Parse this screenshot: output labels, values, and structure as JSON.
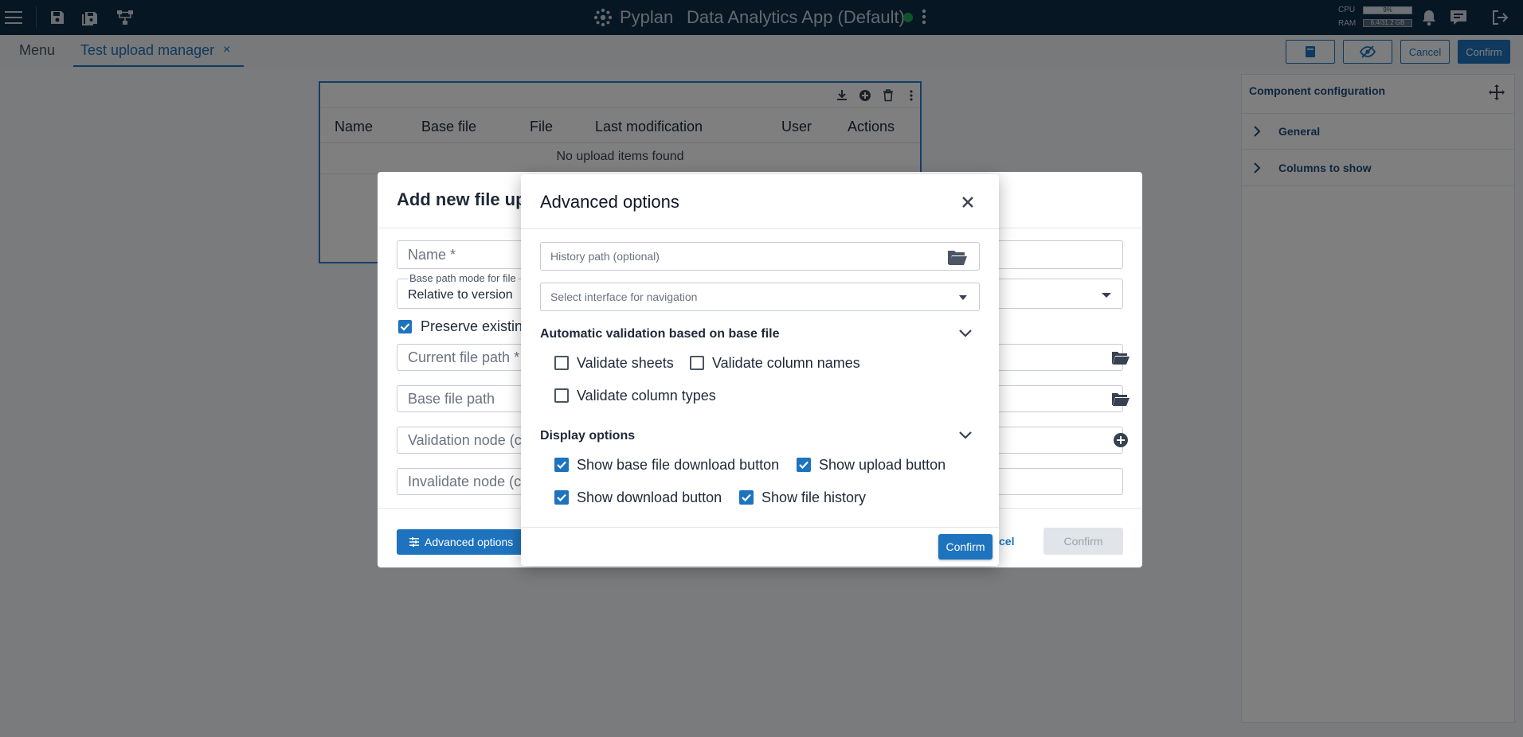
{
  "topbar": {
    "brand": "Pyplan",
    "app_title": "Data Analytics App (Default)",
    "cpu_label": "CPU",
    "cpu_value": "9%",
    "ram_label": "RAM",
    "ram_value": "6.4/31.2 GB"
  },
  "tabs": {
    "menu_label": "Menu",
    "active_tab": "Test upload manager",
    "close_glyph": "×"
  },
  "toolbar_right": {
    "cancel_label": "Cancel",
    "confirm_label": "Confirm"
  },
  "widget": {
    "columns": [
      "Name",
      "Base file",
      "File",
      "Last modification",
      "User",
      "Actions"
    ],
    "empty_text": "No upload items found"
  },
  "right_panel": {
    "title": "Component configuration",
    "sections": [
      "General",
      "Columns to show"
    ]
  },
  "dialog": {
    "title": "Add new file up",
    "name_placeholder": "Name *",
    "base_path_label": "Base path mode for file",
    "base_path_value": "Relative to version",
    "preserve_label": "Preserve existin",
    "current_file_placeholder": "Current file path *",
    "base_file_placeholder": "Base file path",
    "validation_node_placeholder": "Validation node (c",
    "invalidate_node_placeholder": "Invalidate node (c",
    "advanced_button": "Advanced options",
    "cancel_fragment": "cel",
    "confirm_label": "Confirm"
  },
  "modal": {
    "title": "Advanced options",
    "history_path_placeholder": "History path (optional)",
    "interface_placeholder": "Select interface for navigation",
    "validation_section": {
      "title": "Automatic validation based on base file",
      "options": [
        {
          "label": "Validate sheets",
          "checked": false
        },
        {
          "label": "Validate column names",
          "checked": false
        },
        {
          "label": "Validate column types",
          "checked": false
        }
      ]
    },
    "display_section": {
      "title": "Display options",
      "options": [
        {
          "label": "Show base file download button",
          "checked": true
        },
        {
          "label": "Show upload button",
          "checked": true
        },
        {
          "label": "Show download button",
          "checked": true
        },
        {
          "label": "Show file history",
          "checked": true
        }
      ]
    },
    "confirm_label": "Confirm"
  },
  "colors": {
    "topbar": "#0f2c47",
    "accent": "#1e73be",
    "status_ok": "#1ea94c"
  },
  "icons": {
    "topbar": [
      "hamburger-icon",
      "save-icon",
      "save-all-icon",
      "diagram-icon",
      "pyplan-logo-icon",
      "kebab-icon",
      "bell-icon",
      "chat-icon",
      "logout-icon"
    ],
    "widget": [
      "download-icon",
      "add-circle-icon",
      "trash-icon",
      "kebab-icon"
    ],
    "modal": [
      "close-icon",
      "folder-open-icon",
      "caret-down-icon",
      "chevron-down-icon"
    ]
  }
}
